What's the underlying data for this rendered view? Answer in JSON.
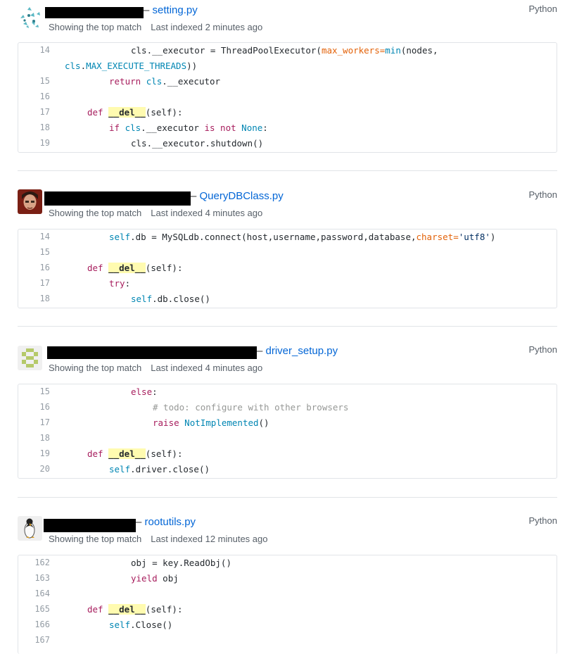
{
  "results": [
    {
      "filename": "setting.py",
      "language": "Python",
      "match_label": "Showing the top match",
      "indexed": "Last indexed 2 minutes ago",
      "lines": [
        "14",
        "15",
        "16",
        "17",
        "18",
        "19"
      ]
    },
    {
      "filename": "QueryDBClass.py",
      "language": "Python",
      "match_label": "Showing the top match",
      "indexed": "Last indexed 4 minutes ago",
      "lines": [
        "14",
        "15",
        "16",
        "17",
        "18"
      ]
    },
    {
      "filename": "driver_setup.py",
      "language": "Python",
      "match_label": "Showing the top match",
      "indexed": "Last indexed 4 minutes ago",
      "lines": [
        "15",
        "16",
        "17",
        "18",
        "19",
        "20"
      ]
    },
    {
      "filename": "rootutils.py",
      "language": "Python",
      "match_label": "Showing the top match",
      "indexed": "Last indexed 12 minutes ago",
      "lines": [
        "162",
        "163",
        "164",
        "165",
        "166",
        "167"
      ]
    }
  ],
  "code": {
    "r0": {
      "l14a": "cls.__executor = ThreadPoolExecutor(",
      "l14b": "max_workers",
      "l14c": "=",
      "l14d": "min",
      "l14e": "(nodes,",
      "l14w_cls": "cls",
      "l14w_rest": ".",
      "l14w_const": "MAX_EXECUTE_THREADS",
      "l14w_end": "))",
      "l15_kw": "return",
      "l15_cls": "cls",
      "l15_rest": ".__executor",
      "l17_def": "def",
      "l17_name": "__del__",
      "l17_rest": "(self):",
      "l18_if": "if",
      "l18_cls": "cls",
      "l18_mid": ".__executor ",
      "l18_is": "is not",
      "l18_none": "None",
      "l18_end": ":",
      "l19": "cls.__executor.shutdown()"
    },
    "r1": {
      "l14_self": "self",
      "l14_mid": ".db = MySQLdb.connect(host,username,password,database,",
      "l14_arg": "charset",
      "l14_eq": "=",
      "l14_str": "'utf8'",
      "l14_end": ")",
      "l16_def": "def",
      "l16_name": "__del__",
      "l16_rest": "(self):",
      "l17_try": "try",
      "l17_end": ":",
      "l18_self": "self",
      "l18_rest": ".db.close()"
    },
    "r2": {
      "l15_else": "else",
      "l15_end": ":",
      "l16_comment": "# todo: configure with other browsers",
      "l17_raise": "raise",
      "l17_exc": "NotImplemented",
      "l17_end": "()",
      "l19_def": "def",
      "l19_name": "__del__",
      "l19_rest": "(self):",
      "l20_self": "self",
      "l20_rest": ".driver.close()"
    },
    "r3": {
      "l162": "obj = key.ReadObj()",
      "l163_yield": "yield",
      "l163_rest": " obj",
      "l165_def": "def",
      "l165_name": "__del__",
      "l165_rest": "(self):",
      "l166_self": "self",
      "l166_rest": ".Close()"
    }
  }
}
